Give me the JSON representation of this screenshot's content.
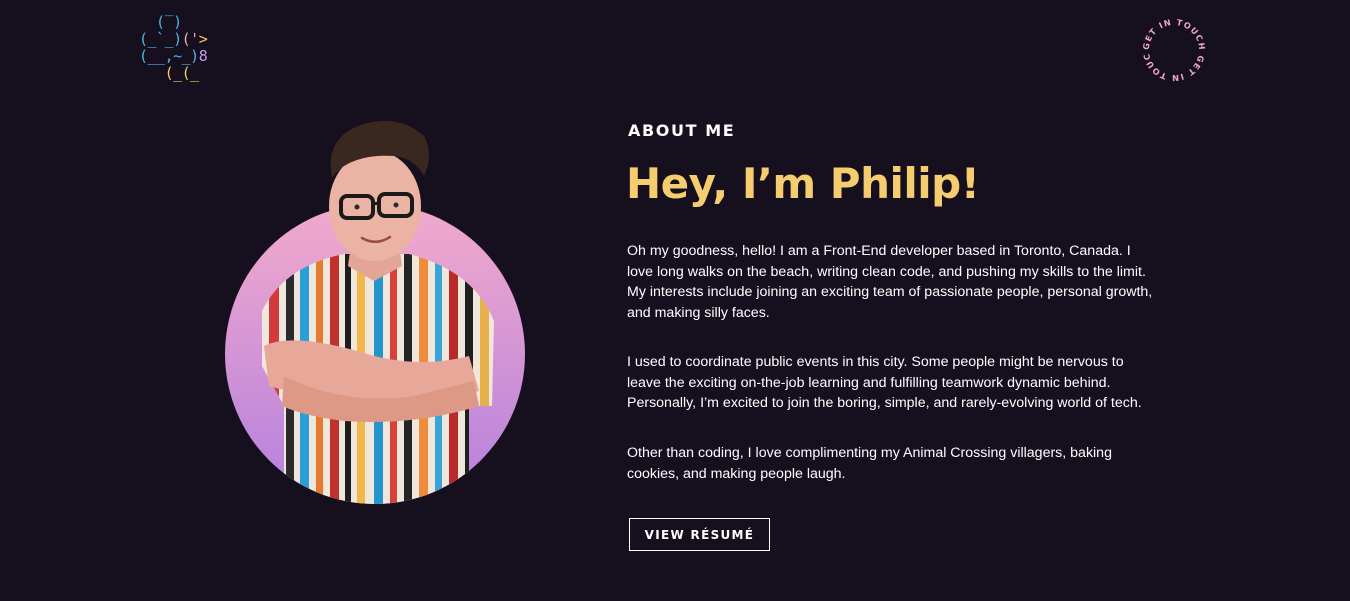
{
  "header": {
    "logo": {
      "icon": "ascii-bear-logo-icon",
      "lines": [
        [
          {
            "t": "  (‾)",
            "c": "blue"
          }
        ],
        [
          {
            "t": "(_`_)",
            "c": "blue"
          },
          {
            "t": "('",
            "c": "pink"
          },
          {
            "t": ">",
            "c": "yellow"
          }
        ],
        [
          {
            "t": "(__,~_)",
            "c": "blue"
          },
          {
            "t": "8",
            "c": "purple"
          }
        ],
        [
          {
            "t": "   (_(_",
            "c": "yellow"
          }
        ]
      ]
    },
    "contact_badge": {
      "text": "GET IN TOUCH GET IN TOUCH",
      "color": "#f2a7c3"
    }
  },
  "about": {
    "eyebrow": "ABOUT ME",
    "headline": "Hey, I’m Philip!",
    "paragraphs": [
      "Oh my goodness, hello! I am a Front-End developer based in Toronto, Canada. I love long walks on the beach, writing clean code, and pushing my skills to the limit. My interests include joining an exciting team of passionate people, personal growth, and making silly faces.",
      "I used to coordinate public events in this city. Some people might be nervous to leave the exciting on-the-job learning and fulfilling teamwork dynamic behind. Personally, I’m excited to join the boring, simple, and rarely-evolving world of tech.",
      "Other than coding, I love complimenting my Animal Crossing villagers, baking cookies, and making people laugh."
    ],
    "resume_button": "VIEW RÉSUMÉ"
  },
  "colors": {
    "background": "#160f1d",
    "accent_yellow": "#f5cd6f",
    "accent_pink": "#f2a7c3",
    "gradient_top": "#f2aacb",
    "gradient_bottom": "#b47fe0",
    "text": "#ffffff"
  }
}
